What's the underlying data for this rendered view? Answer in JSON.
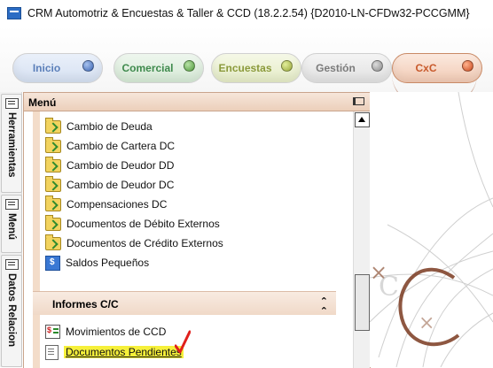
{
  "window": {
    "title": "CRM Automotriz & Encuestas & Taller & CCD (18.2.2.54) {D2010-LN-CFDw32-PCCGMM}"
  },
  "modules": [
    {
      "label": "Inicio"
    },
    {
      "label": "Comercial"
    },
    {
      "label": "Encuestas"
    },
    {
      "label": "Gestión"
    },
    {
      "label": "CxC",
      "active": true
    }
  ],
  "side_tabs": [
    {
      "label": "Herramientas"
    },
    {
      "label": "Menú"
    },
    {
      "label": "Datos Relacion"
    }
  ],
  "menu": {
    "title": "Menú",
    "items": [
      {
        "label": "Cambio de Deuda",
        "icon": "folder-arrow-icon"
      },
      {
        "label": "Cambio de Cartera DC",
        "icon": "folder-arrow-icon"
      },
      {
        "label": "Cambio de Deudor DD",
        "icon": "folder-arrow-icon"
      },
      {
        "label": "Cambio de Deudor DC",
        "icon": "folder-arrow-icon"
      },
      {
        "label": "Compensaciones DC",
        "icon": "folder-arrow-icon"
      },
      {
        "label": "Documentos de Débito Externos",
        "icon": "folder-arrow-icon"
      },
      {
        "label": "Documentos de Crédito Externos",
        "icon": "folder-arrow-icon"
      },
      {
        "label": "Saldos Pequeños",
        "icon": "money-icon"
      }
    ],
    "section": {
      "title": "Informes C/C",
      "items": [
        {
          "label": "Movimientos de CCD",
          "icon": "movements-icon"
        },
        {
          "label": "Documentos Pendientes",
          "icon": "document-icon",
          "highlighted": true
        }
      ]
    }
  },
  "colors": {
    "accent": "#c85a2c",
    "highlight": "#f6f03a",
    "annotation": "#e0201c"
  }
}
